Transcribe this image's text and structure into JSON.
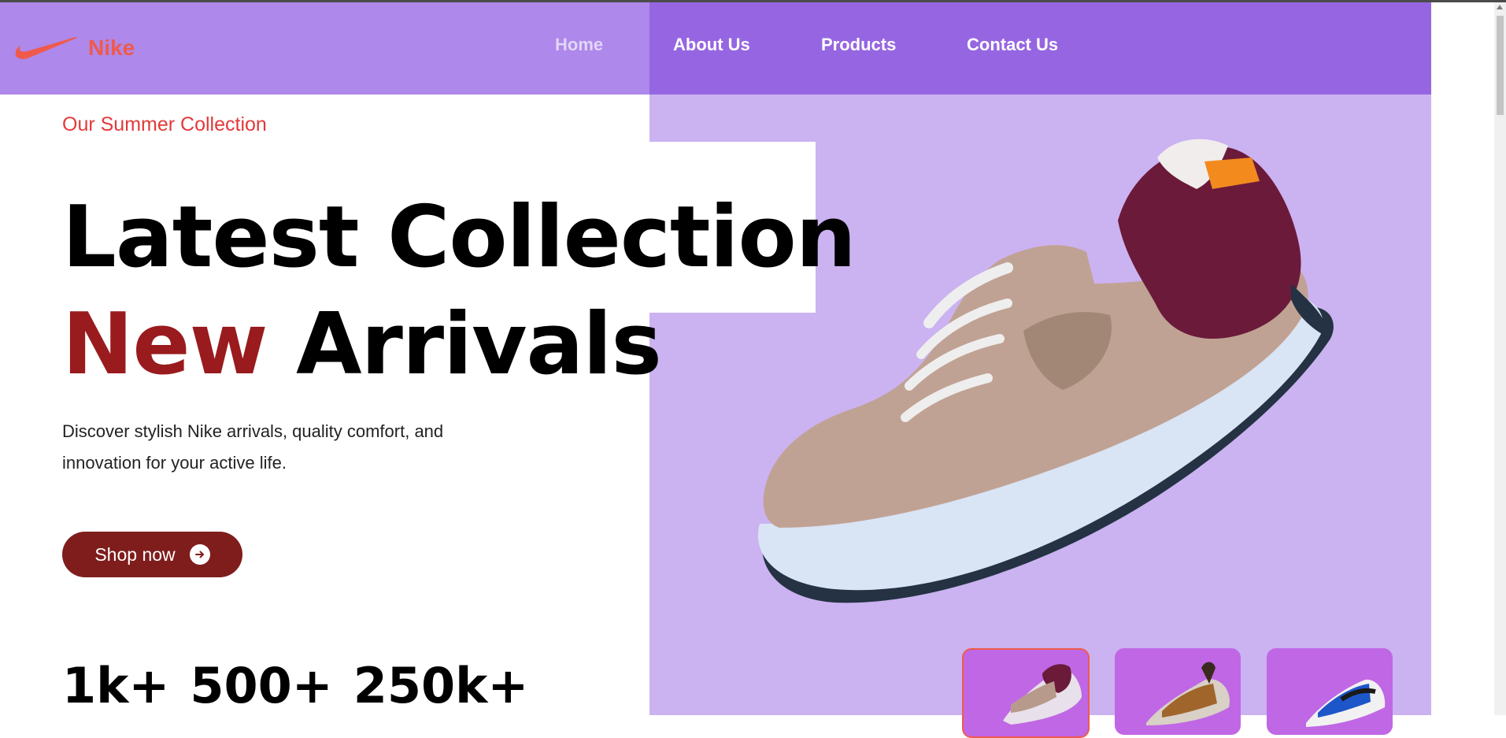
{
  "brand": {
    "name": "Nike",
    "logo_icon": "swoosh-icon",
    "logo_color": "#ef5a4c"
  },
  "nav": {
    "items": [
      {
        "label": "Home"
      },
      {
        "label": "About Us"
      },
      {
        "label": "Products"
      },
      {
        "label": "Contact Us"
      }
    ]
  },
  "hero": {
    "eyebrow": "Our Summer Collection",
    "headline_line1": "Latest Collection",
    "headline_new": "New",
    "headline_rest": " Arrivals",
    "description": "Discover stylish Nike arrivals, quality comfort, and innovation for your active life.",
    "cta_label": "Shop now",
    "cta_icon": "arrow-right-circle-icon"
  },
  "stats": [
    {
      "value": "1k+"
    },
    {
      "value": "500+"
    },
    {
      "value": "250k+"
    }
  ],
  "colors": {
    "accent": "#991b1e",
    "cta_bg": "#7f1d1d",
    "header_bg": "#ae88ea",
    "header_active_bg": "#9666e2",
    "hero_panel_bg": "#cbb2f1",
    "thumb_bg": "#c067e5"
  },
  "thumbnails": [
    {
      "name": "thumb-shoe-1",
      "selected": true
    },
    {
      "name": "thumb-shoe-2",
      "selected": false
    },
    {
      "name": "thumb-shoe-3",
      "selected": false
    }
  ]
}
